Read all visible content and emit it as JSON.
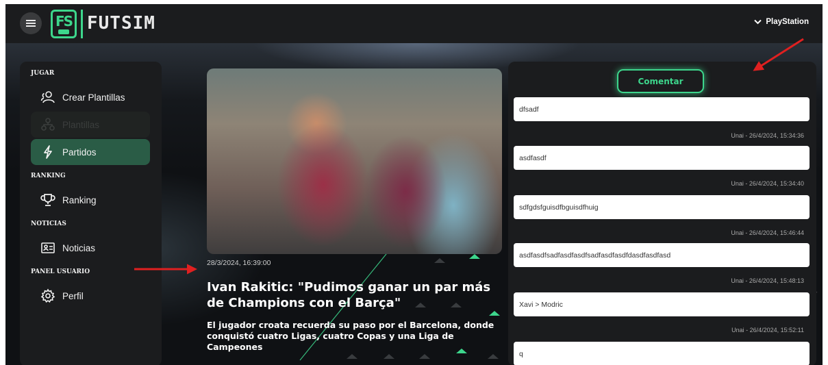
{
  "header": {
    "logo_text": "FS",
    "brand": "FUTSIM",
    "platform": "PlayStation"
  },
  "sidebar": {
    "sections": [
      {
        "label": "JUGAR",
        "items": [
          {
            "label": "Crear Plantillas",
            "icon": "users-icon",
            "state": "normal"
          },
          {
            "label": "Plantillas",
            "icon": "hierarchy-icon",
            "state": "disabled"
          },
          {
            "label": "Partidos",
            "icon": "lightning-icon",
            "state": "active"
          }
        ]
      },
      {
        "label": "RANKING",
        "items": [
          {
            "label": "Ranking",
            "icon": "trophy-icon",
            "state": "normal"
          }
        ]
      },
      {
        "label": "NOTICIAS",
        "items": [
          {
            "label": "Noticias",
            "icon": "id-card-icon",
            "state": "normal"
          }
        ]
      },
      {
        "label": "PANEL USUARIO",
        "items": [
          {
            "label": "Perfil",
            "icon": "gear-icon",
            "state": "normal"
          }
        ]
      }
    ]
  },
  "news": {
    "date": "28/3/2024, 16:39:00",
    "title": "Ivan Rakitic: \"Pudimos ganar un par más de Champions con el Barça\"",
    "subtitle": "El jugador croata recuerda su paso por el Barcelona, donde conquistó cuatro Ligas, cuatro Copas y una Liga de Campeones"
  },
  "comments": {
    "button_label": "Comentar",
    "items": [
      {
        "text": "dfsadf",
        "meta": "Unai - 26/4/2024, 15:34:36"
      },
      {
        "text": "asdfasdf",
        "meta": "Unai - 26/4/2024, 15:34:40"
      },
      {
        "text": "sdfgdsfguisdfbguisdfhuig",
        "meta": "Unai - 26/4/2024, 15:46:44"
      },
      {
        "text": "asdfasdfsadfasdfasdfsadfasdfasdfdasdfasdfasd",
        "meta": "Unai - 26/4/2024, 15:48:13"
      },
      {
        "text": "Xavi > Modric",
        "meta": "Unai - 26/4/2024, 15:52:11"
      },
      {
        "text": "q",
        "meta": ""
      }
    ]
  },
  "colors": {
    "accent": "#3dd68c",
    "active_item": "#2a5c46",
    "panel": "#1b1c1e",
    "annotation_arrow": "#e02020"
  }
}
